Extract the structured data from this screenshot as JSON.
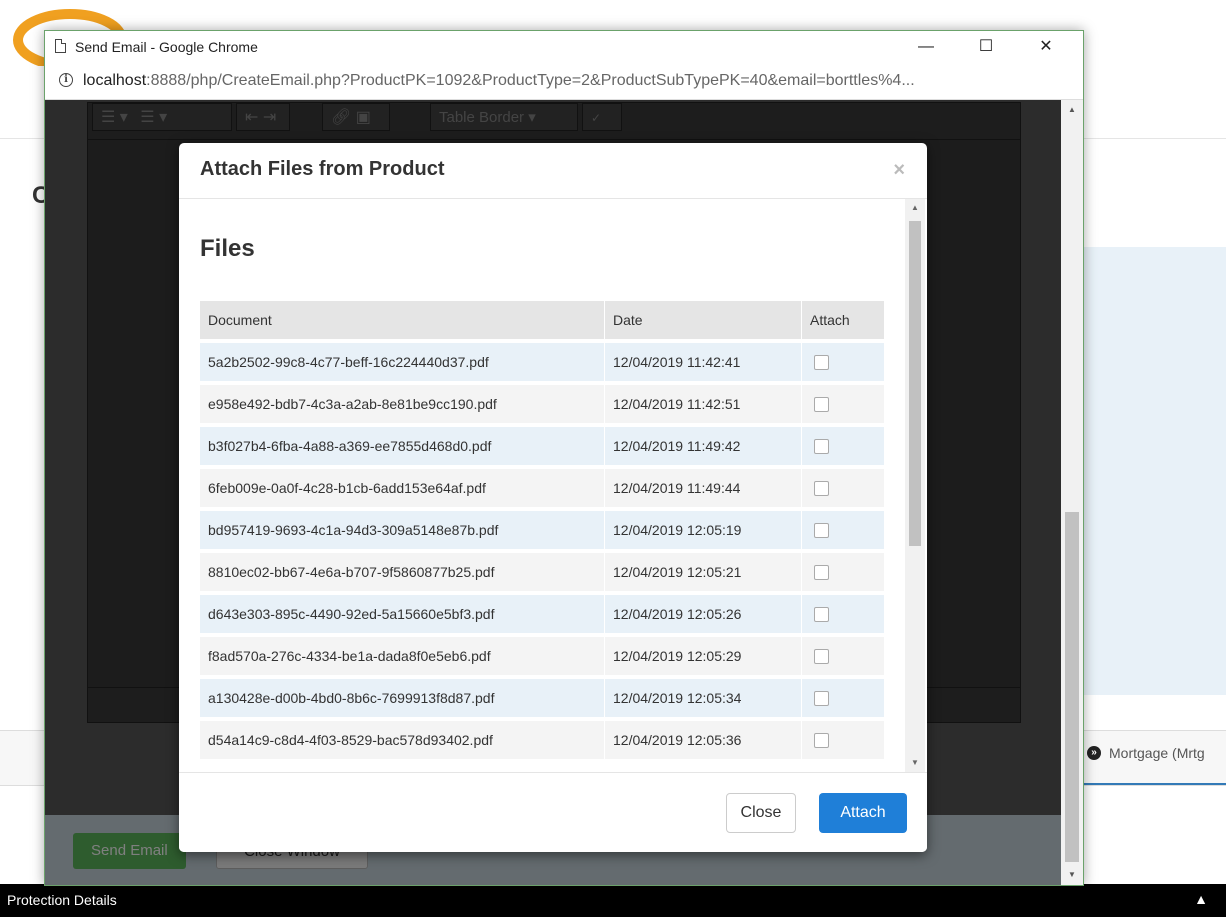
{
  "background": {
    "heading_partial": "C",
    "tab_partial": "Mortgage (Mrtg",
    "footer_label": "Protection Details",
    "footer_chevron": "^"
  },
  "window": {
    "title": "Send Email - Google Chrome",
    "minimize": "—",
    "maximize": "☐",
    "close": "✕",
    "url_host": "localhost",
    "url_rest": ":8888/php/CreateEmail.php?ProductPK=1092&ProductType=2&ProductSubTypePK=40&email=borttles%4...",
    "toolbar": {
      "bullets": "☰ ▾",
      "numbers": "☰ ▾",
      "table_border": "Table Border ▾"
    },
    "send_button": "Send Email",
    "close_window_button": "Close Window"
  },
  "modal": {
    "title": "Attach Files from Product",
    "close_x": "×",
    "section_heading": "Files",
    "columns": [
      "Document",
      "Date",
      "Attach"
    ],
    "rows": [
      {
        "document": "5a2b2502-99c8-4c77-beff-16c224440d37.pdf",
        "date": "12/04/2019 11:42:41"
      },
      {
        "document": "e958e492-bdb7-4c3a-a2ab-8e81be9cc190.pdf",
        "date": "12/04/2019 11:42:51"
      },
      {
        "document": "b3f027b4-6fba-4a88-a369-ee7855d468d0.pdf",
        "date": "12/04/2019 11:49:42"
      },
      {
        "document": "6feb009e-0a0f-4c28-b1cb-6add153e64af.pdf",
        "date": "12/04/2019 11:49:44"
      },
      {
        "document": "bd957419-9693-4c1a-94d3-309a5148e87b.pdf",
        "date": "12/04/2019 12:05:19"
      },
      {
        "document": "8810ec02-bb67-4e6a-b707-9f5860877b25.pdf",
        "date": "12/04/2019 12:05:21"
      },
      {
        "document": "d643e303-895c-4490-92ed-5a15660e5bf3.pdf",
        "date": "12/04/2019 12:05:26"
      },
      {
        "document": "f8ad570a-276c-4334-be1a-dada8f0e5eb6.pdf",
        "date": "12/04/2019 12:05:29"
      },
      {
        "document": "a130428e-d00b-4bd0-8b6c-7699913f8d87.pdf",
        "date": "12/04/2019 12:05:34"
      },
      {
        "document": "d54a14c9-c8d4-4f03-8529-bac578d93402.pdf",
        "date": "12/04/2019 12:05:36"
      }
    ],
    "close_button": "Close",
    "attach_button": "Attach"
  },
  "colors": {
    "attach_blue": "#1f7fd8",
    "send_green": "#5cb85c",
    "row_blue": "#e8f1f8",
    "row_gray": "#f4f4f4"
  }
}
